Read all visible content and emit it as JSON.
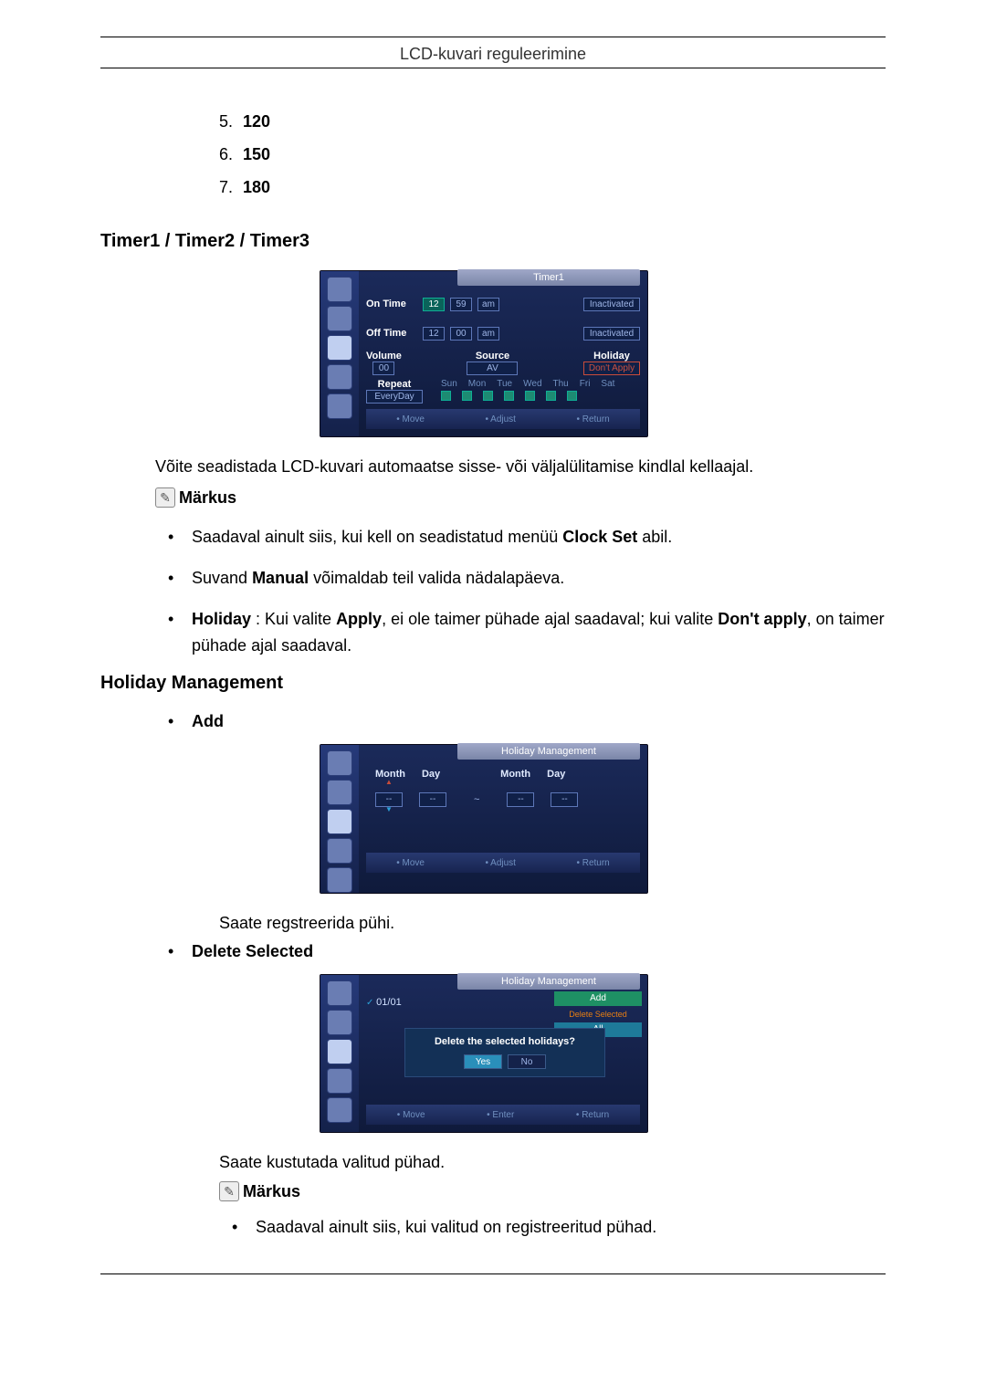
{
  "header": {
    "title": "LCD-kuvari reguleerimine"
  },
  "prev_list": [
    {
      "num": "5.",
      "val": "120"
    },
    {
      "num": "6.",
      "val": "150"
    },
    {
      "num": "7.",
      "val": "180"
    }
  ],
  "timer_section": {
    "heading": "Timer1 / Timer2 / Timer3",
    "osd": {
      "title": "Timer1",
      "on_time": {
        "label": "On Time",
        "hour": "12",
        "min": "59",
        "ampm": "am",
        "state": "Inactivated"
      },
      "off_time": {
        "label": "Off Time",
        "hour": "12",
        "min": "00",
        "ampm": "am",
        "state": "Inactivated"
      },
      "volume": {
        "label": "Volume",
        "value": "00"
      },
      "source": {
        "label": "Source",
        "value": "AV"
      },
      "holiday": {
        "label": "Holiday",
        "value": "Don't Apply"
      },
      "repeat": {
        "label": "Repeat",
        "value": "EveryDay"
      },
      "days": [
        "Sun",
        "Mon",
        "Tue",
        "Wed",
        "Thu",
        "Fri",
        "Sat"
      ],
      "footer": {
        "move": "Move",
        "adjust": "Adjust",
        "return": "Return"
      }
    },
    "paragraph": "Võite seadistada LCD-kuvari automaatse sisse- või väljalülitamise kindlal kellaajal.",
    "note_label": "Märkus",
    "bullets": {
      "b1_pre": "Saadaval ainult siis, kui kell on seadistatud menüü ",
      "b1_bold": "Clock Set",
      "b1_post": " abil.",
      "b2_pre": "Suvand ",
      "b2_bold": "Manual",
      "b2_post": " võimaldab teil valida nädalapäeva.",
      "b3_bold1": "Holiday",
      "b3_mid1": " : Kui valite ",
      "b3_bold2": "Apply",
      "b3_mid2": ", ei ole taimer pühade ajal saadaval; kui valite ",
      "b3_bold3": "Don't apply",
      "b3_post": ", on taimer pühade ajal saadaval."
    }
  },
  "holiday_section": {
    "heading": "Holiday Management",
    "add": {
      "label": "Add",
      "osd": {
        "title": "Holiday Management",
        "month": "Month",
        "day": "Day",
        "dash1": "--",
        "dash2": "--",
        "tilde": "~",
        "dash3": "--",
        "dash4": "--",
        "footer": {
          "move": "Move",
          "adjust": "Adjust",
          "return": "Return"
        }
      },
      "paragraph": "Saate regstreerida pühi."
    },
    "delete": {
      "label": "Delete Selected",
      "osd": {
        "title": "Holiday Management",
        "entry": "01/01",
        "menu": {
          "add": "Add",
          "delete_selected": "Delete Selected",
          "all": "All"
        },
        "dialog": {
          "text": "Delete the selected holidays?",
          "yes": "Yes",
          "no": "No"
        },
        "footer": {
          "move": "Move",
          "enter": "Enter",
          "return": "Return"
        }
      },
      "paragraph": "Saate kustutada valitud pühad.",
      "note_label": "Märkus",
      "bullet": "Saadaval ainult siis, kui valitud on registreeritud pühad."
    }
  }
}
